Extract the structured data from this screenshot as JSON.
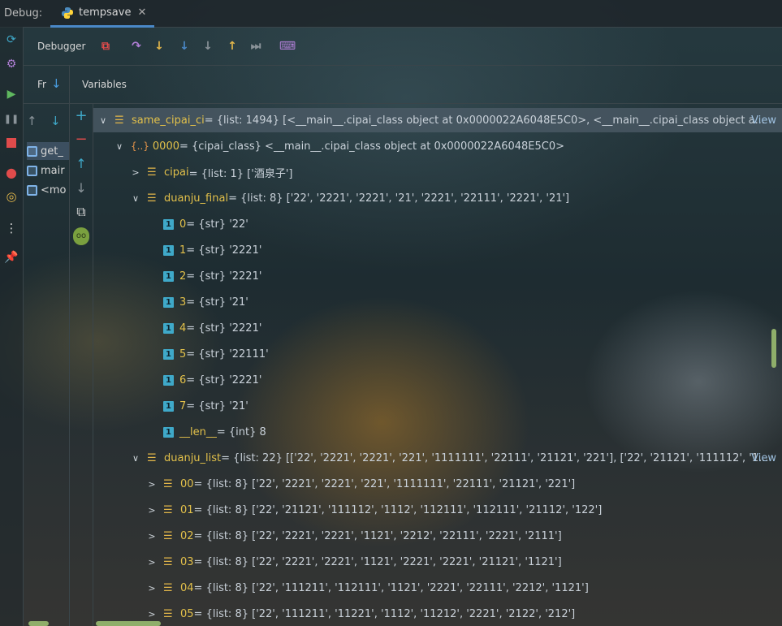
{
  "topbar": {
    "debug_label": "Debug:",
    "tab_title": "tempsave",
    "close_glyph": "✕"
  },
  "left_strip_icons": [
    "rerun-icon",
    "settings-icon",
    "resume-icon",
    "pause-icon",
    "stop-icon",
    "breakpoints-icon",
    "mute-breakpoints-icon",
    "more-icon",
    "pin-icon"
  ],
  "toolbar": {
    "debugger_label": "Debugger",
    "icons": [
      "show-execution-point-icon",
      "step-over-icon",
      "step-into-icon",
      "step-into-my-code-icon",
      "force-step-into-icon",
      "step-out-icon",
      "run-to-cursor-icon",
      "evaluate-expression-icon"
    ]
  },
  "subheader": {
    "frames_label": "Fr",
    "variables_label": "Variables"
  },
  "frames": {
    "items": [
      {
        "label": "get_",
        "selected": true
      },
      {
        "label": "mair",
        "selected": false
      },
      {
        "label": "<mo",
        "selected": false
      }
    ]
  },
  "tree": {
    "rows": [
      {
        "chev": "∨",
        "icon": "list",
        "name": "same_cipai_ci",
        "value": " = {list: 1494} [<__main__.cipai_class object at 0x0000022A6048E5C0>, <__main__.cipai_class object a...",
        "view": "View",
        "selected": true,
        "level": 0
      },
      {
        "chev": "∨",
        "icon": "object",
        "name": "0000",
        "value": " = {cipai_class} <__main__.cipai_class object at 0x0000022A6048E5C0>",
        "view": "",
        "selected": false,
        "level": 1
      },
      {
        "chev": ">",
        "icon": "list",
        "name": "cipai",
        "value": " = {list: 1} ['酒泉子']",
        "view": "",
        "selected": false,
        "level": 2
      },
      {
        "chev": "∨",
        "icon": "list",
        "name": "duanju_final",
        "value": " = {list: 8} ['22', '2221', '2221', '21', '2221', '22111', '2221', '21']",
        "view": "",
        "selected": false,
        "level": 2
      },
      {
        "chev": "",
        "icon": "str",
        "name": "0",
        "value": " = {str} '22'",
        "view": "",
        "selected": false,
        "level": 3
      },
      {
        "chev": "",
        "icon": "str",
        "name": "1",
        "value": " = {str} '2221'",
        "view": "",
        "selected": false,
        "level": 3
      },
      {
        "chev": "",
        "icon": "str",
        "name": "2",
        "value": " = {str} '2221'",
        "view": "",
        "selected": false,
        "level": 3
      },
      {
        "chev": "",
        "icon": "str",
        "name": "3",
        "value": " = {str} '21'",
        "view": "",
        "selected": false,
        "level": 3
      },
      {
        "chev": "",
        "icon": "str",
        "name": "4",
        "value": " = {str} '2221'",
        "view": "",
        "selected": false,
        "level": 3
      },
      {
        "chev": "",
        "icon": "str",
        "name": "5",
        "value": " = {str} '22111'",
        "view": "",
        "selected": false,
        "level": 3
      },
      {
        "chev": "",
        "icon": "str",
        "name": "6",
        "value": " = {str} '2221'",
        "view": "",
        "selected": false,
        "level": 3
      },
      {
        "chev": "",
        "icon": "str",
        "name": "7",
        "value": " = {str} '21'",
        "view": "",
        "selected": false,
        "level": 3
      },
      {
        "chev": "",
        "icon": "str",
        "name": "__len__",
        "value": " = {int} 8",
        "view": "",
        "selected": false,
        "level": 3
      },
      {
        "chev": "∨",
        "icon": "list",
        "name": "duanju_list",
        "value": " = {list: 22} [['22', '2221', '2221', '221', '1111111', '22111', '21121', '221'], ['22', '21121', '111112', '1...",
        "view": "View",
        "selected": false,
        "level": 2
      },
      {
        "chev": ">",
        "icon": "list",
        "name": "00",
        "value": " = {list: 8} ['22', '2221', '2221', '221', '1111111', '22111', '21121', '221']",
        "view": "",
        "selected": false,
        "level": 3
      },
      {
        "chev": ">",
        "icon": "list",
        "name": "01",
        "value": " = {list: 8} ['22', '21121', '111112', '1112', '112111', '112111', '21112', '122']",
        "view": "",
        "selected": false,
        "level": 3
      },
      {
        "chev": ">",
        "icon": "list",
        "name": "02",
        "value": " = {list: 8} ['22', '2221', '2221', '1121', '2212', '22111', '2221', '2111']",
        "view": "",
        "selected": false,
        "level": 3
      },
      {
        "chev": ">",
        "icon": "list",
        "name": "03",
        "value": " = {list: 8} ['22', '2221', '2221', '1121', '2221', '2221', '21121', '1121']",
        "view": "",
        "selected": false,
        "level": 3
      },
      {
        "chev": ">",
        "icon": "list",
        "name": "04",
        "value": " = {list: 8} ['22', '111211', '112111', '1121', '2221', '22111', '2212', '1121']",
        "view": "",
        "selected": false,
        "level": 3
      },
      {
        "chev": ">",
        "icon": "list",
        "name": "05",
        "value": " = {list: 8} ['22', '111211', '11221', '1112', '11212', '2221', '2122', '212']",
        "view": "",
        "selected": false,
        "level": 3
      }
    ]
  },
  "colors": {
    "accent": "#4a88c7",
    "var_name": "#e2c04a",
    "list_icon": "#e2b64a",
    "str_icon": "#3fa9c9"
  }
}
